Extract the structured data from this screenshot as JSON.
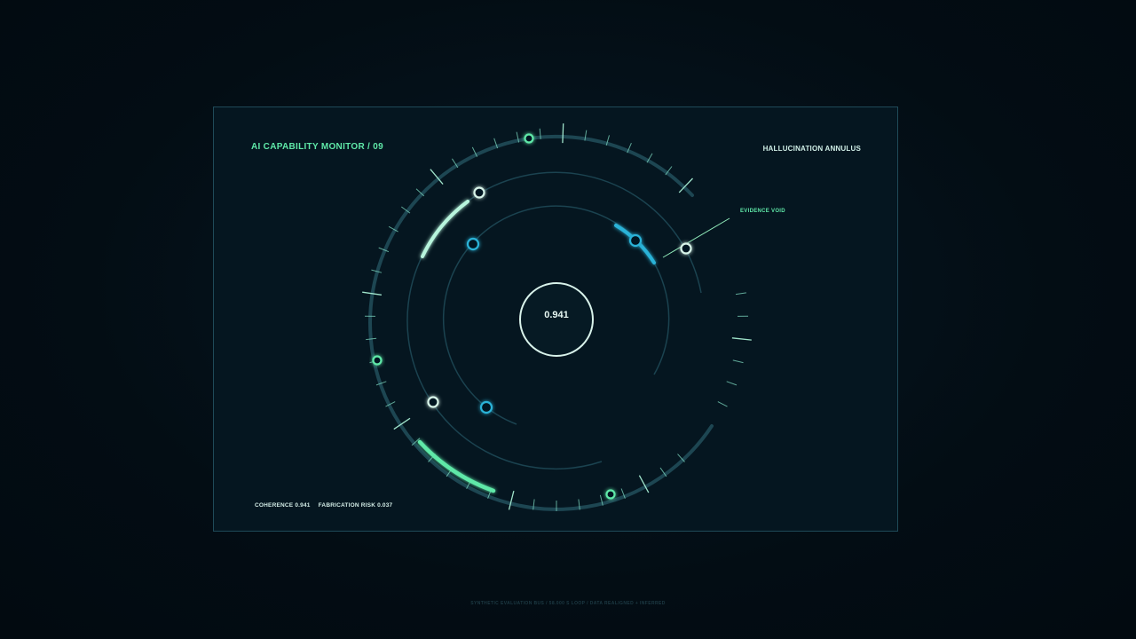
{
  "monitor": {
    "title": "AI CAPABILITY MONITOR / 09",
    "mode_label": "HALLUCINATION ANNULUS",
    "center_value": "0.941",
    "callout": "EVIDENCE VOID",
    "metrics": {
      "coherence": "COHERENCE 0.941",
      "fabrication_risk": "FABRICATION RISK 0.037"
    },
    "footer": "SYNTHETIC EVALUATION BUS  /  58.000 S LOOP  /  DATA REALIGNED + INFERRED"
  },
  "colors": {
    "accent_green": "#5fe8a8",
    "accent_teal": "#2ab3d8",
    "ring_line": "#1f4a58",
    "text_light": "#e6f7f2"
  }
}
